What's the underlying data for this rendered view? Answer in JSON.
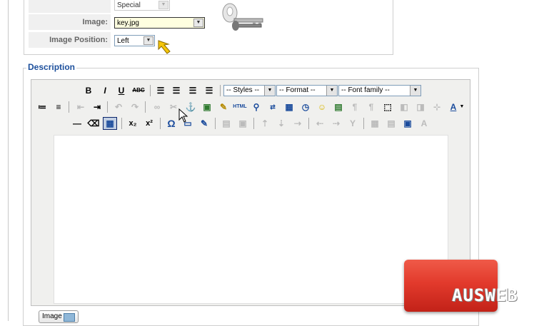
{
  "params": {
    "special_value": "Special",
    "image_label": "Image:",
    "image_value": "key.jpg",
    "image_position_label": "Image Position:",
    "image_position_value": "Left"
  },
  "description": {
    "legend": "Description",
    "toolbar": {
      "bold": "B",
      "italic": "I",
      "underline": "U",
      "strikethrough": "ABC",
      "styles": "-- Styles --",
      "format": "-- Format --",
      "font_family": "-- Font family --",
      "html_label": "HTML",
      "subscript": "x₂",
      "superscript": "x²",
      "omega": "Ω",
      "font_color": "A"
    },
    "editor_content": ""
  },
  "image_button_label": "Image",
  "logo_text": "AUSWEB",
  "colors": {
    "legend": "#1c4f9c",
    "logo_red": "#e23a2c",
    "toolbar_bg": "#f0f0ee"
  }
}
